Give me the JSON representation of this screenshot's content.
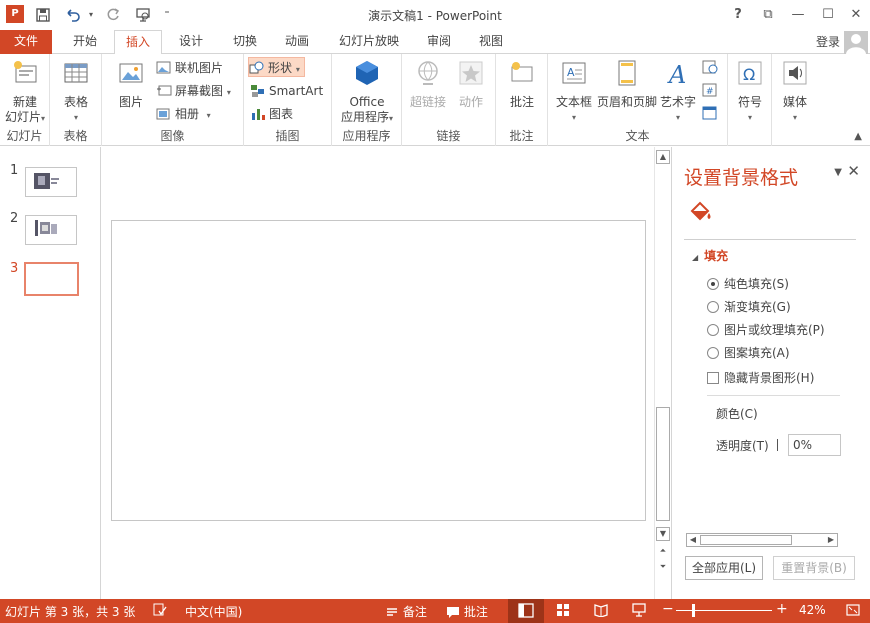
{
  "app": {
    "logo": "P",
    "title": "演示文稿1 - PowerPoint"
  },
  "window": {
    "help": "?",
    "restore_ribbon": "⧉",
    "minimize": "—",
    "maximize": "☐",
    "close": "✕"
  },
  "tabs": [
    {
      "label": "文件"
    },
    {
      "label": "开始"
    },
    {
      "label": "插入"
    },
    {
      "label": "设计"
    },
    {
      "label": "切换"
    },
    {
      "label": "动画"
    },
    {
      "label": "幻灯片放映"
    },
    {
      "label": "审阅"
    },
    {
      "label": "视图"
    }
  ],
  "account": {
    "login": "登录"
  },
  "ribbon": {
    "slides": {
      "new_slide_1": "新建",
      "new_slide_2": "幻灯片",
      "label": "幻灯片"
    },
    "tables": {
      "table": "表格",
      "label": "表格"
    },
    "images": {
      "picture": "图片",
      "online_picture": "联机图片",
      "screenshot": "屏幕截图",
      "album": "相册",
      "label": "图像"
    },
    "illustrations": {
      "shapes": "形状",
      "smartart": "SmartArt",
      "chart": "图表",
      "label": "插图"
    },
    "apps": {
      "office_1": "Office",
      "office_2": "应用程序",
      "label": "应用程序"
    },
    "links": {
      "hyperlink": "超链接",
      "action": "动作",
      "label": "链接"
    },
    "comments": {
      "comment": "批注",
      "label": "批注"
    },
    "text": {
      "textbox": "文本框",
      "header_footer": "页眉和页脚",
      "wordart": "艺术字",
      "label": "文本"
    },
    "symbols": {
      "symbol": "符号"
    },
    "media": {
      "media": "媒体"
    }
  },
  "thumbnails": [
    {
      "num": "1"
    },
    {
      "num": "2"
    },
    {
      "num": "3"
    }
  ],
  "panel": {
    "title": "设置背景格式",
    "fill_header": "填充",
    "options": {
      "solid": "纯色填充(S)",
      "gradient": "渐变填充(G)",
      "picture": "图片或纹理填充(P)",
      "pattern": "图案填充(A)",
      "hide_graphics": "隐藏背景图形(H)"
    },
    "color_label": "颜色(C)",
    "transparency_label": "透明度(T)",
    "transparency_value": "0%",
    "apply_all": "全部应用(L)",
    "reset": "重置背景(B)"
  },
  "status": {
    "slide_info": "幻灯片 第 3 张，共 3 张",
    "language": "中文(中国)",
    "notes": "备注",
    "comments": "批注",
    "zoom_minus": "−",
    "zoom_plus": "+",
    "zoom": "42%"
  },
  "colors": {
    "accent": "#d24726",
    "status_bar": "#d24726",
    "active_view": "#9d3318"
  }
}
